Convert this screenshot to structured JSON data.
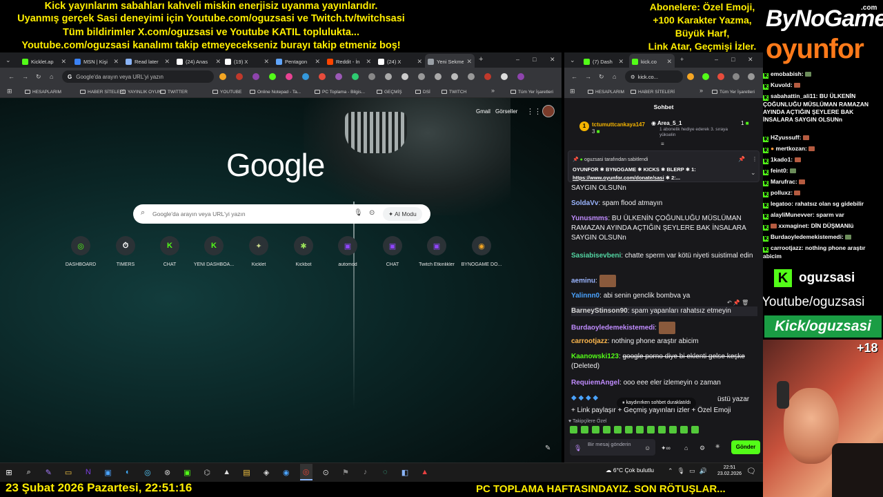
{
  "overlay": {
    "top_lines": [
      "Kick yayınlarım sabahları kahveli miskin enerjisiz uyanma yayınlarıdır.",
      "Uyanmış gerçek Sasi deneyimi için Youtube.com/oguzsasi ve Twitch.tv/twitchsasi",
      "Tüm bildirimler X.com/oguzsasi ve Youtube KATIL toplulukta...",
      "Youtube.com/oguzsasi kanalımı takip etmeyecekseniz burayı takip etmeniz boş!"
    ],
    "right_lines": [
      "Abonelere: Özel Emoji,",
      "+100 Karakter Yazma,",
      "Büyük Harf,",
      "Link Atar, Geçmişi İzler."
    ],
    "logo_top": "ByNoGame",
    "logo_com": ".com",
    "logo_bottom": "oyunfor",
    "channel_name": "oguzsasi",
    "youtube_handle": "Youtube/oguzsasi",
    "kick_handle": "Kick/oguzsasi",
    "age_badge": "+18",
    "bottom_left": "23 Şubat 2026 Pazartesi, 22:51:16",
    "bottom_right": "PC TOPLAMA HAFTASINDAYIZ. SON RÖTUŞLAR...",
    "chat": [
      {
        "user": "emobabish",
        "text": ""
      },
      {
        "user": "Kuvold",
        "text": ""
      },
      {
        "user": "sabahattin_ali11",
        "text": "BU ÜLKENİN ÇOĞUNLUĞU MÜSLÜMAN RAMAZAN AYINDA AÇTIĞIN ŞEYLERE BAK İNSALARA SAYGIN OLSUNn"
      },
      {
        "user": "HZyussuff",
        "text": ""
      },
      {
        "user": "mertkozan",
        "text": ""
      },
      {
        "user": "1kado1",
        "text": ""
      },
      {
        "user": "feint0",
        "text": ""
      },
      {
        "user": "Marufrac",
        "text": ""
      },
      {
        "user": "polluxz",
        "text": ""
      },
      {
        "user": "legatoo",
        "text": "rahatsız olan sg gidebilir"
      },
      {
        "user": "alayliMunevver",
        "text": "sparm var"
      },
      {
        "user": "xxmaginet",
        "text": "DİN DÜŞMANIü"
      },
      {
        "user": "Burdaoyledemekistemedi",
        "text": ""
      },
      {
        "user": "carrootjazz",
        "text": "nothing phone araştır abicim"
      }
    ]
  },
  "left_browser": {
    "tabs": [
      {
        "label": "Kicklet.ap",
        "color": "#53fc18"
      },
      {
        "label": "MSN | Kişi",
        "color": "#3b82f6"
      },
      {
        "label": "Read later",
        "color": "#8ab4f8"
      },
      {
        "label": "(24) Anas",
        "color": "#ffffff"
      },
      {
        "label": "(19) X",
        "color": "#ffffff"
      },
      {
        "label": "Pentagon",
        "color": "#60a5fa"
      },
      {
        "label": "Reddit - İn",
        "color": "#ff4500"
      },
      {
        "label": "(24) X",
        "color": "#ffffff"
      },
      {
        "label": "Yeni Sekme",
        "color": "#9aa0a6"
      }
    ],
    "url_placeholder": "Google'da arayın veya URL'yi yazın",
    "bookmarks": [
      "HESAPLARIM",
      "HABER SİTELERİ",
      "YAYINLIK OYUN",
      "TWITTER",
      "YOUTUBE",
      "Online Notepad - Ta...",
      "PC Toplama - Bilgis...",
      "GEÇMİŞ",
      "DSİ",
      "TWITCH"
    ],
    "all_bookmarks": "Tüm Yer İşaretleri",
    "gmail": "Gmail",
    "images": "Görseller",
    "google_logo": "Google",
    "search_placeholder": "Google'da arayın veya URL'yi yazın",
    "ai_mode": "AI Modu",
    "shortcuts": [
      {
        "label": "DASHBOARD",
        "glyph": "◎",
        "color": "#53fc18"
      },
      {
        "label": "TIMERS",
        "glyph": "⏱",
        "color": "#ffffff"
      },
      {
        "label": "CHAT",
        "glyph": "K",
        "color": "#53fc18"
      },
      {
        "label": "YENİ DASHBOA...",
        "glyph": "K",
        "color": "#53fc18"
      },
      {
        "label": "Kicklet",
        "glyph": "✦",
        "color": "#c8d88a"
      },
      {
        "label": "Kickbot",
        "glyph": "✱",
        "color": "#9be35a"
      },
      {
        "label": "automod",
        "glyph": "▣",
        "color": "#9146ff"
      },
      {
        "label": "CHAT",
        "glyph": "▣",
        "color": "#9146ff"
      },
      {
        "label": "Twitch Etkinlikler",
        "glyph": "▣",
        "color": "#9146ff"
      },
      {
        "label": "BYNOGAME DO...",
        "glyph": "◉",
        "color": "#f5a623"
      }
    ]
  },
  "right_browser": {
    "tabs": [
      {
        "label": "(7) Dash",
        "color": "#53fc18"
      },
      {
        "label": "kick.co",
        "color": "#53fc18"
      }
    ],
    "url": "kick.co...",
    "bookmarks": [
      "HESAPLARIM",
      "HABER SİTELERİ"
    ],
    "all_bookmarks": "Tüm Yer İşaretleri",
    "chat_title": "Sohbet",
    "gift_top": {
      "user": "tctumuttcankaya147",
      "count": "3"
    },
    "gift_side": {
      "user": "Area_5_1",
      "detail": "1 abonelik hediye ederek 3. sıraya yükselin",
      "count": "1"
    },
    "pinned": {
      "by": "oguzsasi tarafından sabitlendi",
      "line1": "OYUNFOR ✱ BYNOGAME ✱ KICKS ✱ BLERP ✱ 1:",
      "link": "https://www.oyunfor.com/donate/sasi",
      "tail": "✱ 2:..."
    },
    "messages": [
      {
        "user": "",
        "text": "SAYGIN OLSUNn",
        "color": "#ffffff"
      },
      {
        "user": "SoldaVv",
        "text": "spam flood atmayın",
        "color": "#9ab4ff"
      },
      {
        "user": "Yunusmms",
        "text": "BU ÜLKENİN ÇOĞUNLUĞU MÜSLÜMAN RAMAZAN AYINDA AÇTIĞIN ŞEYLERE BAK İNSALARA SAYGIN OLSUNn",
        "color": "#c08cff"
      },
      {
        "user": "Sasiabisevbeni",
        "text": "chatte sperm var kötü niyeti suistimal edin",
        "color": "#53d6a3"
      },
      {
        "user": "aeminu",
        "text": "",
        "color": "#9ab4ff"
      },
      {
        "user": "Yalinnn0",
        "text": "abi senin genclik bombva ya",
        "color": "#4aa3ff"
      },
      {
        "user": "BarneyStinson90",
        "text": "spam yapanları rahatsız etmeyin",
        "color": "#d9d9d9"
      },
      {
        "user": "Burdaoyledemekistemedi",
        "text": "",
        "color": "#c08cff"
      },
      {
        "user": "carrootjazz",
        "text": "nothing phone araştır abicim",
        "color": "#ffb84d"
      },
      {
        "user": "Kaanowski123",
        "text": "google porno diye bi eklenti gelse keşke",
        "deleted": "(Deleted)",
        "color": "#53fc18"
      },
      {
        "user": "RequiemAngel",
        "text": "ooo eee eler izlemeyin o zaman",
        "color": "#c08cff"
      }
    ],
    "partial_line_1": "üstü yazar",
    "partial_line_2": "+ Link paylaşır + Geçmiş yayınları izler + Özel Emoji",
    "paused": "kaydırırken sohbet duraklatıldı",
    "subs_only": "Takipçilere Özel",
    "input_placeholder": "Bir mesaj gönderin",
    "send": "Gönder"
  },
  "taskbar": {
    "weather": "6°C  Çok bulutlu",
    "time": "22:51",
    "date": "23.02.2026"
  }
}
